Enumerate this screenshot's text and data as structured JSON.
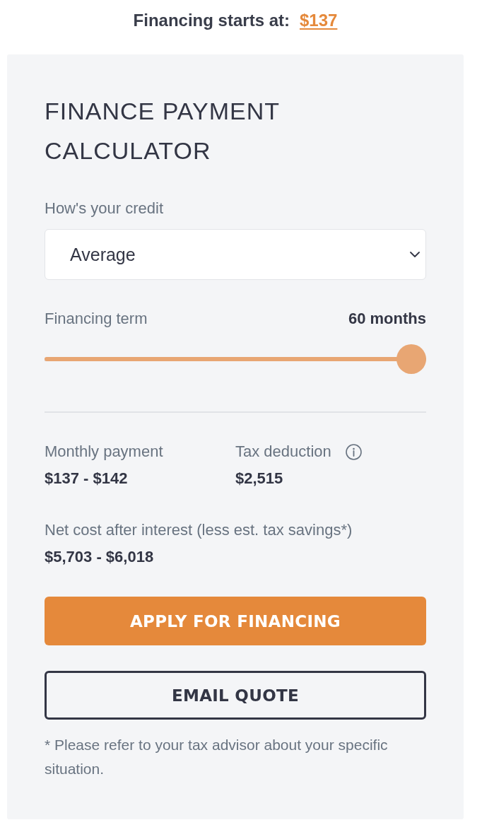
{
  "header": {
    "label": "Financing starts at:",
    "price_link": "$137"
  },
  "calculator": {
    "title": "FINANCE PAYMENT CALCULATOR",
    "credit": {
      "label": "How's your credit",
      "value": "Average"
    },
    "term": {
      "label": "Financing term",
      "reading": "60 months",
      "level": 1
    },
    "results": [
      {
        "label": "Monthly payment",
        "value": "$137 - $142",
        "info": false
      },
      {
        "label": "Tax deduction",
        "value": "$2,515",
        "info": true
      }
    ],
    "net_cost": {
      "label": "Net cost after interest (less est. tax savings*)",
      "value": "$5,703 - $6,018"
    },
    "buttons": [
      {
        "label": "APPLY FOR FINANCING",
        "kind": "primary"
      },
      {
        "label": "EMAIL QUOTE",
        "kind": "outline"
      }
    ],
    "footnote": "* Please refer to your tax advisor about your specific situation."
  }
}
